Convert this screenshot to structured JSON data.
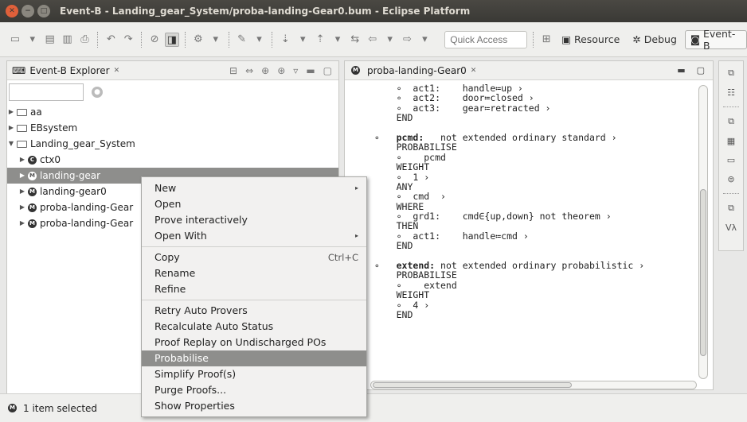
{
  "window": {
    "title": "Event-B - Landing_gear_System/proba-landing-Gear0.bum - Eclipse Platform",
    "close_glyph": "✕",
    "min_glyph": "−",
    "max_glyph": "□"
  },
  "toolbar": {
    "quick_access_placeholder": "Quick Access",
    "perspectives": [
      {
        "label": "Resource",
        "icon": "resource-icon"
      },
      {
        "label": "Debug",
        "icon": "debug-icon"
      },
      {
        "label": "Event-B",
        "icon": "eventb-icon"
      }
    ]
  },
  "explorer": {
    "tab_label": "Event-B Explorer",
    "tab_close": "✕",
    "tree": [
      {
        "label": "aa",
        "arrow": "▶",
        "icon": "folder-icon",
        "indent": 0
      },
      {
        "label": "EBsystem",
        "arrow": "▶",
        "icon": "folder-icon",
        "indent": 0
      },
      {
        "label": "Landing_gear_System",
        "arrow": "▼",
        "icon": "folder-icon",
        "indent": 0
      },
      {
        "label": "ctx0",
        "arrow": "▶",
        "icon": "context-icon",
        "indent": 1
      },
      {
        "label": "landing-gear",
        "arrow": "▶",
        "icon": "machine-icon",
        "indent": 1,
        "selected": true
      },
      {
        "label": "landing-gear0",
        "arrow": "▶",
        "icon": "machine-icon",
        "indent": 1
      },
      {
        "label": "proba-landing-Gear",
        "arrow": "▶",
        "icon": "machine-icon",
        "indent": 1
      },
      {
        "label": "proba-landing-Gear",
        "arrow": "▶",
        "icon": "machine-icon",
        "indent": 1
      }
    ]
  },
  "status": {
    "text": "1 item selected"
  },
  "editor": {
    "tab_label": "proba-landing-Gear0",
    "tab_close": "✕",
    "lines": [
      {
        "t": "     ∘  act1:    handle≔up ›"
      },
      {
        "t": "     ∘  act2:    door≔closed ›"
      },
      {
        "t": "     ∘  act3:    gear≔retracted ›"
      },
      {
        "t": "     END"
      },
      {
        "t": ""
      },
      {
        "t": " ∘   pcmd:   not extended ordinary standard ›",
        "bold": "pcmd:"
      },
      {
        "t": "     PROBABILISE"
      },
      {
        "t": "     ∘    pcmd"
      },
      {
        "t": "     WEIGHT"
      },
      {
        "t": "     ∘  1 ›"
      },
      {
        "t": "     ANY"
      },
      {
        "t": "     ∘  cmd  ›"
      },
      {
        "t": "     WHERE"
      },
      {
        "t": "     ∘  grd1:    cmd∈{up,down} not theorem ›"
      },
      {
        "t": "     THEN"
      },
      {
        "t": "     ∘  act1:    handle≔cmd ›"
      },
      {
        "t": "     END"
      },
      {
        "t": ""
      },
      {
        "t": " ∘   extend: not extended ordinary probabilistic ›",
        "bold": "extend:"
      },
      {
        "t": "     PROBABILISE"
      },
      {
        "t": "     ∘    extend"
      },
      {
        "t": "     WEIGHT"
      },
      {
        "t": "     ∘  4 ›"
      },
      {
        "t": "     END"
      }
    ]
  },
  "context_menu": {
    "groups": [
      [
        {
          "label": "New",
          "submenu": true
        },
        {
          "label": "Open"
        },
        {
          "label": "Prove interactively"
        },
        {
          "label": "Open With",
          "submenu": true
        }
      ],
      [
        {
          "label": "Copy",
          "shortcut": "Ctrl+C"
        },
        {
          "label": "Rename"
        },
        {
          "label": "Refine"
        }
      ],
      [
        {
          "label": "Retry Auto Provers"
        },
        {
          "label": "Recalculate Auto Status"
        },
        {
          "label": "Proof Replay on Undischarged POs"
        },
        {
          "label": "Probabilise",
          "highlighted": true
        },
        {
          "label": "Simplify Proof(s)"
        },
        {
          "label": "Purge Proofs..."
        },
        {
          "label": "Show Properties"
        }
      ]
    ]
  }
}
